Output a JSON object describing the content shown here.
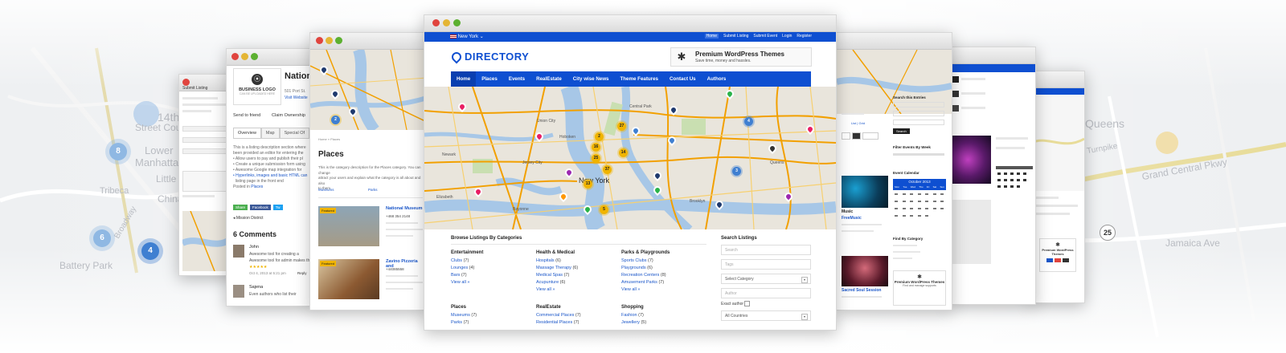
{
  "background": {
    "labels": [
      "14th",
      "Street Cours",
      "Lower",
      "Manhatta",
      "Tribeca",
      "Little",
      "China",
      "Battery Park",
      "Broadway",
      "Queens",
      "Turnpike",
      "Grand Central Pkwy",
      "Jamaica Ave"
    ],
    "clusters": [
      "8",
      "6",
      "4",
      "25"
    ]
  },
  "left_far": {
    "title": "Submit Listing"
  },
  "left_listing": {
    "title": "Nation",
    "logo_line1": "BUSINESS LOGO",
    "logo_line2": "CAN BE UPLOADED HERE",
    "address": "501 Port St.",
    "site_link": "Visit Website",
    "action_send": "Send to friend",
    "action_claim": "Claim Ownership",
    "tabs": [
      "Overview",
      "Map",
      "Special Of"
    ],
    "body_lines": [
      "This is a listing description section where",
      "been provided an editor for entering the"
    ],
    "bullets": [
      "Allow users to pay and publish their pl",
      "Create a unique submission form using",
      "Awesome Google map integration for",
      "Hyperlinks, images and basic HTML can",
      "listing page in the front end"
    ],
    "posted_in_label": "Posted in",
    "posted_in_value": "Places",
    "share_buttons": [
      "Share",
      "Facebook",
      "Tw"
    ],
    "mission": "Mission District",
    "comments_title": "6 Comments",
    "comment1_author": "John",
    "comment1_text": "Awesome tool for creating a",
    "comment1_text2": "Awesome tool for admin makes the",
    "comment1_date": "Oct 4, 2013 at 5:21 pm",
    "comment1_reply": "Reply",
    "comment2_author": "Sajena",
    "comment2_text": "Even authors who list their"
  },
  "left_places": {
    "breadcrumb": "Home » Places",
    "title": "Places",
    "desc": "This is the category description for the Places category. You can change",
    "desc2": "attract your users and explain what the category is all about and also",
    "desc3": "to them",
    "filters": [
      "Museums",
      "Parks"
    ],
    "items": [
      {
        "badge": "Featured",
        "title": "National Museum",
        "phone": "+468 354 2148"
      },
      {
        "badge": "Featured",
        "title": "Zavino Pizzeria and",
        "phone": "+44085558"
      }
    ]
  },
  "main": {
    "topbar": {
      "location": "New York",
      "links": [
        "Home",
        "Submit Listing",
        "Submit Event",
        "Login",
        "Register"
      ]
    },
    "logo_text": "DIRECTORY",
    "ad": {
      "title": "Premium WordPress Themes",
      "subtitle": "Save time, money and hassles."
    },
    "nav": [
      "Home",
      "Places",
      "Events",
      "RealEstate",
      "City wise News",
      "Theme Features",
      "Contact Us",
      "Authors"
    ],
    "map_labels": [
      "New York",
      "Jersey City",
      "Newark",
      "Queens",
      "Brooklyn",
      "Central Park",
      "Hoboken",
      "Bayonne",
      "Union City",
      "Elizabeth"
    ],
    "clusters": [
      "27",
      "16",
      "2",
      "14",
      "37",
      "25",
      "13",
      "5",
      "3",
      "4"
    ],
    "browse_title": "Browse Listings By Categories",
    "categories": [
      {
        "title": "Entertainment",
        "items": [
          {
            "name": "Clubs",
            "count": "(7)"
          },
          {
            "name": "Lounges",
            "count": "(4)"
          },
          {
            "name": "Bars",
            "count": "(7)"
          },
          {
            "name": "View all »",
            "count": ""
          }
        ]
      },
      {
        "title": "Health & Medical",
        "items": [
          {
            "name": "Hospitals",
            "count": "(6)"
          },
          {
            "name": "Massage Therapy",
            "count": "(6)"
          },
          {
            "name": "Medical Spas",
            "count": "(7)"
          },
          {
            "name": "Acupunture",
            "count": "(6)"
          },
          {
            "name": "View all »",
            "count": ""
          }
        ]
      },
      {
        "title": "Parks & Playgrounds",
        "items": [
          {
            "name": "Sports Clubs",
            "count": "(7)"
          },
          {
            "name": "Playgrounds",
            "count": "(6)"
          },
          {
            "name": "Recreation Centers",
            "count": "(8)"
          },
          {
            "name": "Amusement Parks",
            "count": "(7)"
          },
          {
            "name": "View all »",
            "count": ""
          }
        ]
      },
      {
        "title": "Places",
        "items": [
          {
            "name": "Museums",
            "count": "(7)"
          },
          {
            "name": "Parks",
            "count": "(7)"
          }
        ]
      },
      {
        "title": "RealEstate",
        "items": [
          {
            "name": "Commercial Places",
            "count": "(7)"
          },
          {
            "name": "Residential Places",
            "count": "(7)"
          }
        ]
      },
      {
        "title": "Shopping",
        "items": [
          {
            "name": "Fashion",
            "count": "(7)"
          },
          {
            "name": "Jewellery",
            "count": "(5)"
          }
        ]
      }
    ],
    "search": {
      "title": "Search Listings",
      "search_placeholder": "Search",
      "tags_placeholder": "Tags",
      "category_select": "Select Category",
      "author_placeholder": "Author",
      "exact_author": "Exact author",
      "countries": "All Countries"
    }
  },
  "right_events": {
    "search_title": "Search this Entries",
    "filter_title": "Filter Events By Week",
    "search_button": "Search",
    "calendar_title": "Event Calendar",
    "calendar_month": "October 2013",
    "weekdays": [
      "Mon",
      "Tue",
      "Wed",
      "Thu",
      "Fri",
      "Sat",
      "Sun"
    ],
    "find_title": "Find By Category",
    "ad_title": "Premium WordPress Themes",
    "ad_sub": "Find and manage supports",
    "event1": "FreeMusic",
    "event2": "Sacred Soul Session"
  },
  "right_news": {
    "ad_caption": "Premium WordPress Themes"
  },
  "colors": {
    "brand_blue": "#0e4fd1",
    "cluster": "#f0b400",
    "map_bg": "#e9e5dc",
    "road": "#f2a000",
    "water": "#a7c7e7"
  }
}
